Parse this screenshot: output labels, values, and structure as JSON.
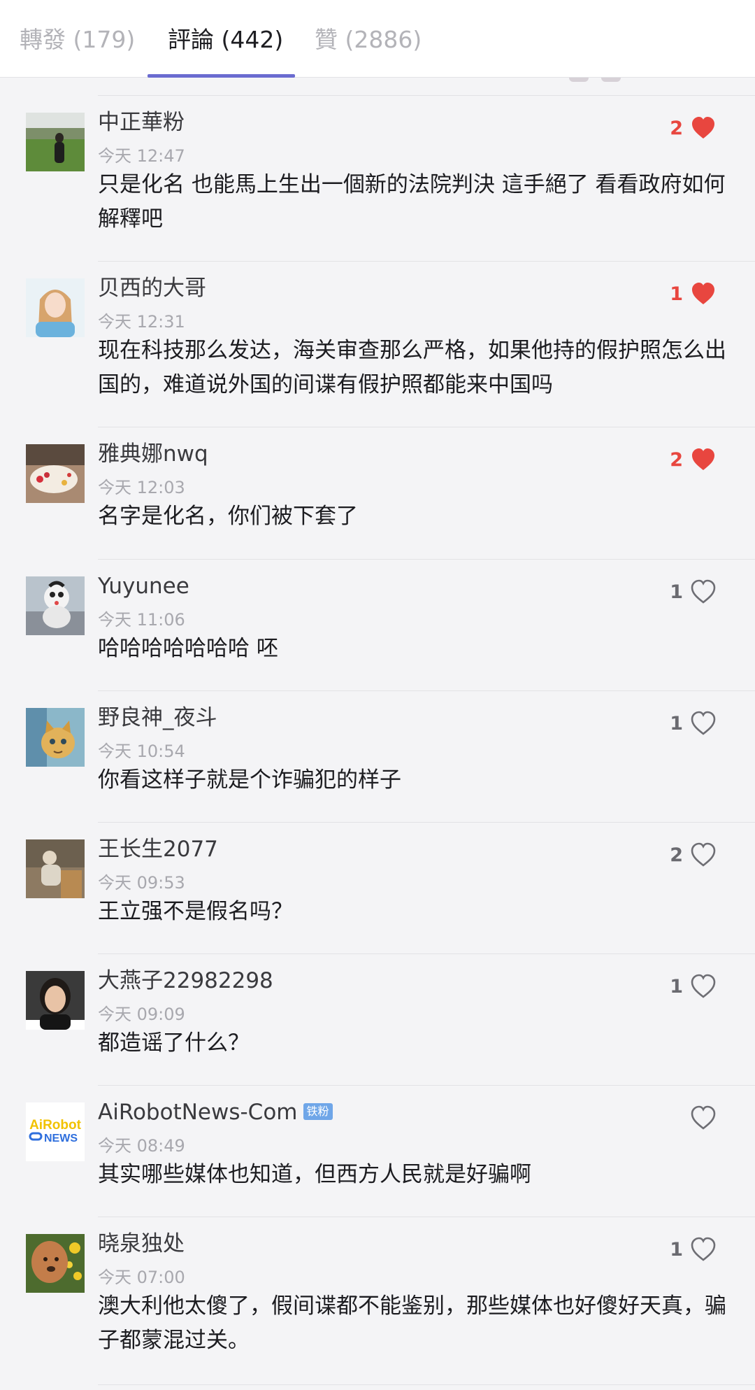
{
  "tabs": [
    {
      "label": "轉發 (179)",
      "active": false
    },
    {
      "label": "評論 (442)",
      "active": true
    },
    {
      "label": "贊 (2886)",
      "active": false
    }
  ],
  "colors": {
    "accent": "#6a6bd0",
    "liked": "#e8463f",
    "verified_badge": "#6fa6e8",
    "timestamp": "#a8a8ae"
  },
  "comments": [
    {
      "name": "中正華粉",
      "time": "今天 12:47",
      "text": "只是化名 也能馬上生出一個新的法院判決 這手絕了 看看政府如何解釋吧",
      "likes": "2",
      "liked": true,
      "avatar_icon": "person-on-field-avatar"
    },
    {
      "name": "贝西的大哥",
      "time": "今天 12:31",
      "text": "现在科技那么发达，海关审查那么严格，如果他持的假护照怎么出国的，难道说外国的间谍有假护照都能来中国吗",
      "likes": "1",
      "liked": true,
      "avatar_icon": "girl-portrait-avatar"
    },
    {
      "name": "雅典娜nwq",
      "time": "今天 12:03",
      "text": "名字是化名，你们被下套了",
      "likes": "2",
      "liked": true,
      "avatar_icon": "cake-avatar"
    },
    {
      "name": "Yuyunee",
      "time": "今天 11:06",
      "text": "哈哈哈哈哈哈哈 呸",
      "likes": "1",
      "liked": false,
      "avatar_icon": "cartoon-toy-avatar"
    },
    {
      "name": "野良神_夜斗",
      "time": "今天 10:54",
      "text": "你看这样子就是个诈骗犯的样子",
      "likes": "1",
      "liked": false,
      "avatar_icon": "cat-painting-avatar"
    },
    {
      "name": "王长生2077",
      "time": "今天 09:53",
      "text": "王立强不是假名吗？",
      "likes": "2",
      "liked": false,
      "avatar_icon": "person-sitting-avatar"
    },
    {
      "name": "大燕子22982298",
      "time": "今天 09:09",
      "text": "都造谣了什么？",
      "likes": "1",
      "liked": false,
      "avatar_icon": "woman-portrait-avatar"
    },
    {
      "name": "AiRobotNews-Com",
      "badge": "铁粉",
      "time": "今天 08:49",
      "text": "其实哪些媒体也知道，但西方人民就是好骗啊",
      "likes": "",
      "liked": false,
      "avatar_icon": "airobot-news-logo-avatar",
      "avatar_logo": {
        "line1": "AiRobot",
        "line2": "NEWS"
      }
    },
    {
      "name": "晓泉独处",
      "time": "今天 07:00",
      "text": "澳大利他太傻了，假间谍都不能鉴别，那些媒体也好傻好天真，骗子都蒙混过关。",
      "likes": "1",
      "liked": false,
      "avatar_icon": "dog-with-flowers-avatar"
    }
  ]
}
